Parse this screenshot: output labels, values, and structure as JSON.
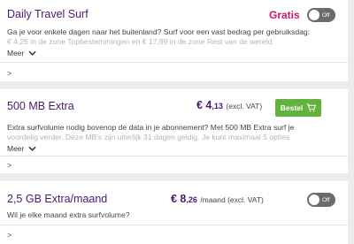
{
  "bundles": [
    {
      "title": "Daily Travel Surf",
      "badge": "Gratis",
      "toggle_label": "Off",
      "desc_line1": "Ga je voor enkele dagen naar het buitenland? Surf voor een vast bedrag per gebruiksdag:",
      "desc_line2": "€ 4,26 in de zone Topbestemmingen en € 17,99 in de zone Rest van de wereld.",
      "more_label": "Meer",
      "arrow_label": ">"
    },
    {
      "title": "500 MB Extra",
      "price_euro": "€ 4",
      "price_cents": ",13",
      "price_suffix": "(excl. VAT)",
      "button_label": "Bestel",
      "desc_line1": "Extra surfvolume nodig bovenop de data in je abonnement? Met 500 MB Extra surf je",
      "desc_line2": "voordelig verder. Deze MB's zijn uiterlijk 31 dagen geldig. Je kunt maximaal 5 opties",
      "more_label": "Meer",
      "arrow_label": ">"
    },
    {
      "title": "2,5 GB Extra/maand",
      "price_euro": "€ 8",
      "price_cents": ",26",
      "price_suffix": "/maand (excl. VAT)",
      "toggle_label": "Off",
      "desc_line1": "Wil je elke maand extra surfvolume?",
      "arrow_label": ">"
    }
  ],
  "colors": {
    "title_purple": "#4a1a6e",
    "gratis_pink": "#d0136b",
    "button_green": "#62b33e",
    "toggle_grey": "#6b6b6b",
    "background": "#ececec"
  },
  "icons": [
    "chevron-down-icon",
    "chevron-right-icon",
    "cart-icon"
  ]
}
